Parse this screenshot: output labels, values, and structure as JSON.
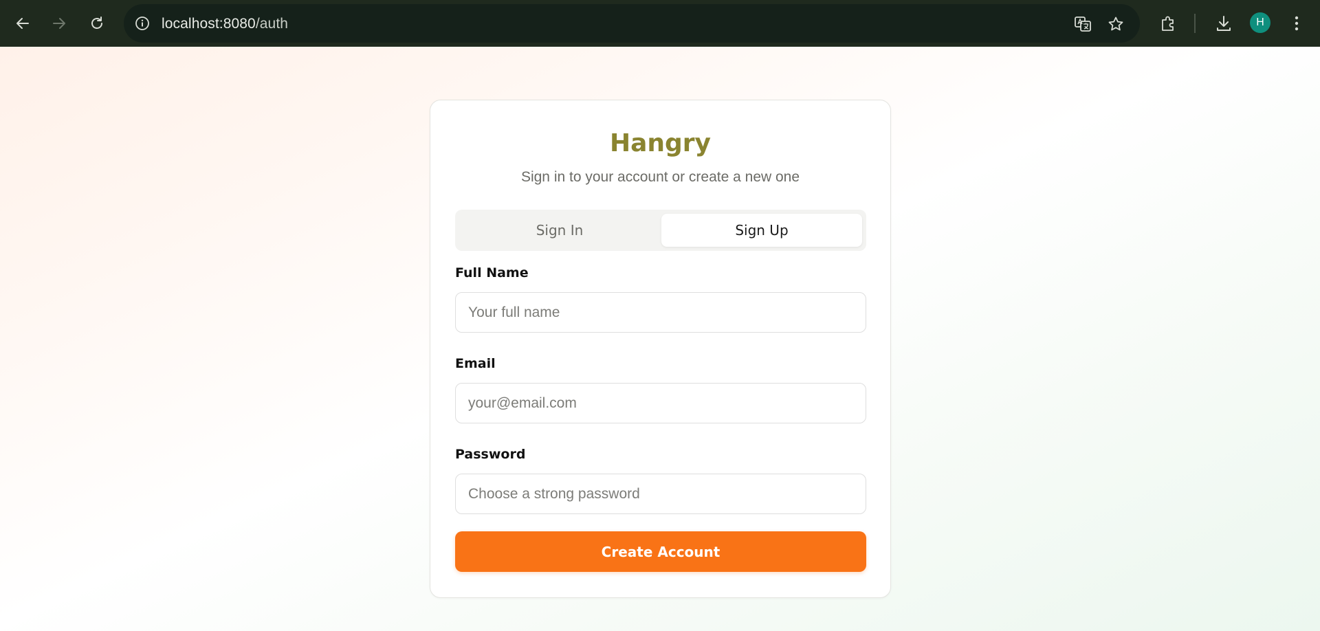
{
  "browser": {
    "url_host": "localhost:8080",
    "url_path": "/auth",
    "profile_initial": "H",
    "icons": [
      "back-icon",
      "forward-icon",
      "reload-icon",
      "info-icon",
      "translate-icon",
      "star-icon",
      "extensions-icon",
      "download-icon",
      "menu-dots-icon"
    ]
  },
  "auth": {
    "brand": "Hangry",
    "subtitle": "Sign in to your account or create a new one",
    "tabs": [
      {
        "label": "Sign In",
        "active": false
      },
      {
        "label": "Sign Up",
        "active": true
      }
    ],
    "fields": [
      {
        "label": "Full Name",
        "placeholder": "Your full name",
        "value": ""
      },
      {
        "label": "Email",
        "placeholder": "your@email.com",
        "value": ""
      },
      {
        "label": "Password",
        "placeholder": "Choose a strong password",
        "value": ""
      }
    ],
    "submit_label": "Create Account"
  },
  "colors": {
    "brand": "#8a8430",
    "accent": "#f97316",
    "chrome_bg": "#1f2a1e",
    "avatar": "#0f8f7e"
  }
}
